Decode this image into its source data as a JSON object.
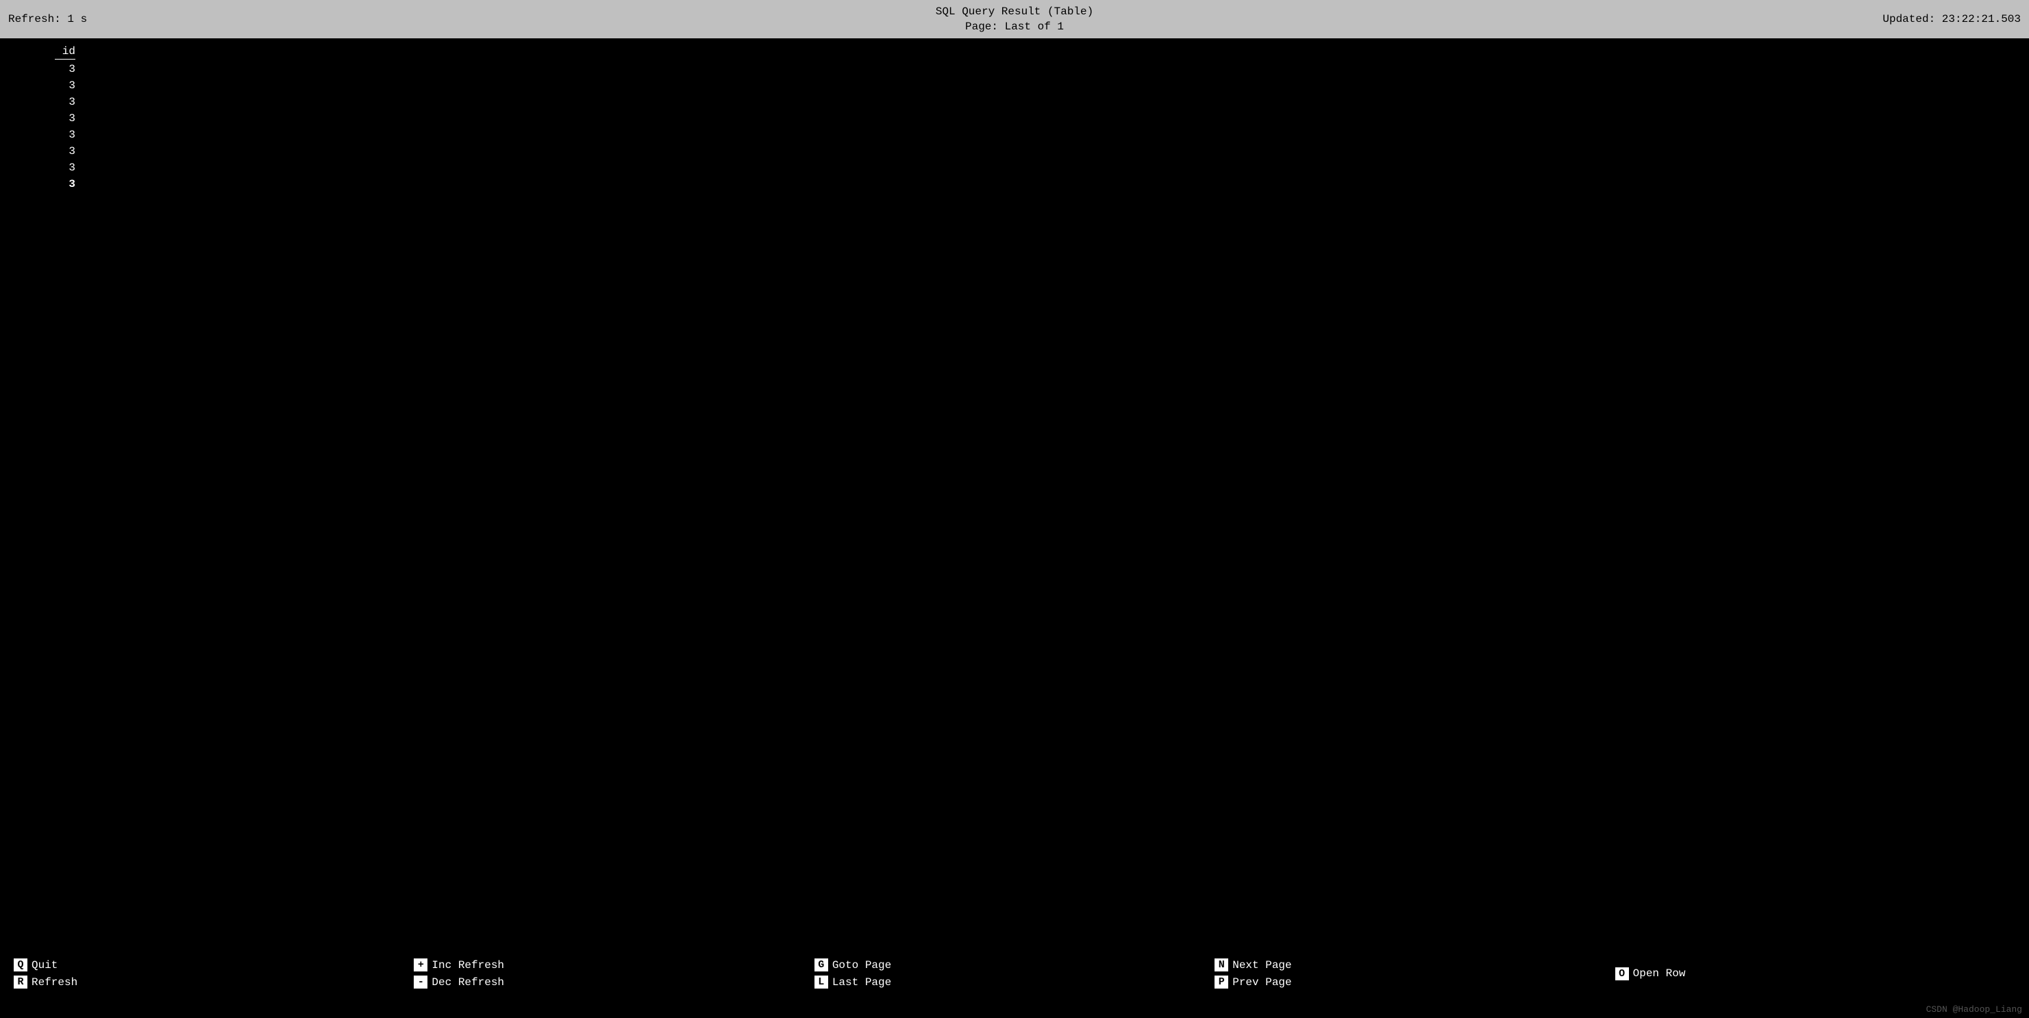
{
  "header": {
    "title_line1": "SQL Query Result (Table)",
    "title_line2": "Page: Last of 1",
    "refresh_label": "Refresh: 1 s",
    "updated_label": "Updated: 23:22:21.503"
  },
  "table": {
    "columns": [
      {
        "name": "id",
        "rows": [
          "3",
          "3",
          "3",
          "3",
          "3",
          "3",
          "3",
          "3"
        ],
        "last_row_bold": true
      }
    ]
  },
  "footer": {
    "sections": [
      {
        "items": [
          {
            "key": "Q",
            "label": "Quit"
          },
          {
            "key": "R",
            "label": "Refresh"
          }
        ]
      },
      {
        "items": [
          {
            "key": "+",
            "label": "Inc Refresh"
          },
          {
            "key": "-",
            "label": "Dec Refresh"
          }
        ]
      },
      {
        "items": [
          {
            "key": "G",
            "label": "Goto Page"
          },
          {
            "key": "L",
            "label": "Last Page"
          }
        ]
      },
      {
        "items": [
          {
            "key": "N",
            "label": "Next Page"
          },
          {
            "key": "P",
            "label": "Prev Page"
          }
        ]
      },
      {
        "items": [
          {
            "key": "O",
            "label": "Open Row"
          }
        ]
      }
    ]
  },
  "watermark": "CSDN @Hadoop_Liang"
}
